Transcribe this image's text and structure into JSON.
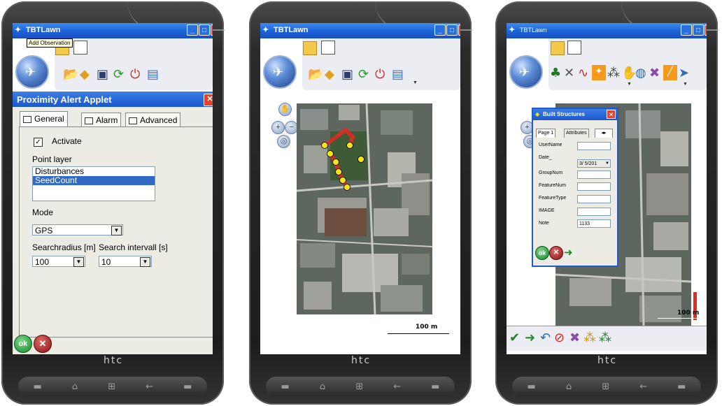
{
  "device": {
    "brand": "htc"
  },
  "hardware_buttons": [
    "call-icon",
    "home-icon",
    "windows-icon",
    "back-icon",
    "end-call-icon"
  ],
  "screen1": {
    "app_title": "TBTLawn",
    "tooltip": "Add Observation",
    "dialog": {
      "title": "Proximity Alert Applet",
      "tabs": [
        "General",
        "Alarm",
        "Advanced"
      ],
      "activate_label": "Activate",
      "activate_checked": true,
      "point_layer_label": "Point layer",
      "point_layers": [
        "Disturbances",
        "SeedCount"
      ],
      "selected_layer": "SeedCount",
      "mode_label": "Mode",
      "mode_value": "GPS",
      "searchradius_label": "Searchradius [m]",
      "searchradius_value": "100",
      "searchinterval_label": "Search intervall [s]",
      "searchinterval_value": "10",
      "ok_label": "ok"
    }
  },
  "screen2": {
    "app_title": "TBTLawn",
    "scale_label": "100 m"
  },
  "screen3": {
    "app_title": "TBTLawn",
    "scale_label": "100 m",
    "form": {
      "title": "Built Structures",
      "tabs": [
        "Page 1",
        "Attributes"
      ],
      "fields": [
        {
          "label": "UserName",
          "value": ""
        },
        {
          "label": "Date_",
          "value": "3/ 5/201"
        },
        {
          "label": "GroupNum",
          "value": ""
        },
        {
          "label": "FeatureNum",
          "value": ""
        },
        {
          "label": "FeatureType",
          "value": ""
        },
        {
          "label": "IMAGE",
          "value": ""
        },
        {
          "label": "Note",
          "value": "1133"
        }
      ],
      "ok_label": "ok"
    }
  },
  "colors": {
    "titlebar_blue": "#1f64d8",
    "selection_blue": "#316ac5",
    "ok_green": "#12882a",
    "cancel_red": "#8c1010",
    "track_red": "#e02b1f",
    "point_yellow": "#f5e21a"
  }
}
